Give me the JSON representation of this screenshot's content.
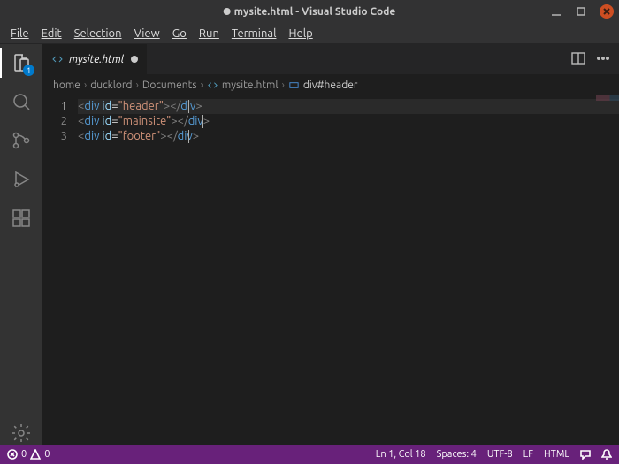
{
  "title": {
    "dirty_indicator": "●",
    "text": "mysite.html - Visual Studio Code"
  },
  "menu": {
    "file": "File",
    "edit": "Edit",
    "selection": "Selection",
    "view": "View",
    "go": "Go",
    "run": "Run",
    "terminal": "Terminal",
    "help": "Help"
  },
  "activitybar": {
    "explorer_badge": "1"
  },
  "tab": {
    "filename": "mysite.html"
  },
  "breadcrumbs": {
    "seg0": "home",
    "seg1": "ducklord",
    "seg2": "Documents",
    "seg3": "mysite.html",
    "seg4": "div#header"
  },
  "editor": {
    "lines": [
      "1",
      "2",
      "3"
    ],
    "l1": {
      "open": "<",
      "el": "div",
      "sp": " ",
      "attr": "id",
      "eq": "=",
      "str": "\"header\"",
      "gt": ">",
      "copen": "</",
      "cel": "div",
      "cgt": ">"
    },
    "l2": {
      "open": "<",
      "el": "div",
      "sp": " ",
      "attr": "id",
      "eq": "=",
      "str": "\"mainsite\"",
      "gt": ">",
      "copen": "</",
      "cel": "div",
      "cgt": ">"
    },
    "l3": {
      "open": "<",
      "el": "div",
      "sp": " ",
      "attr": "id",
      "eq": "=",
      "str": "\"footer\"",
      "gt": ">",
      "copen": "</",
      "cel": "div",
      "cgt": ">"
    }
  },
  "status": {
    "errors": "0",
    "warnings": "0",
    "cursor": "Ln 1, Col 18",
    "spaces": "Spaces: 4",
    "encoding": "UTF-8",
    "eol": "LF",
    "lang": "HTML"
  }
}
